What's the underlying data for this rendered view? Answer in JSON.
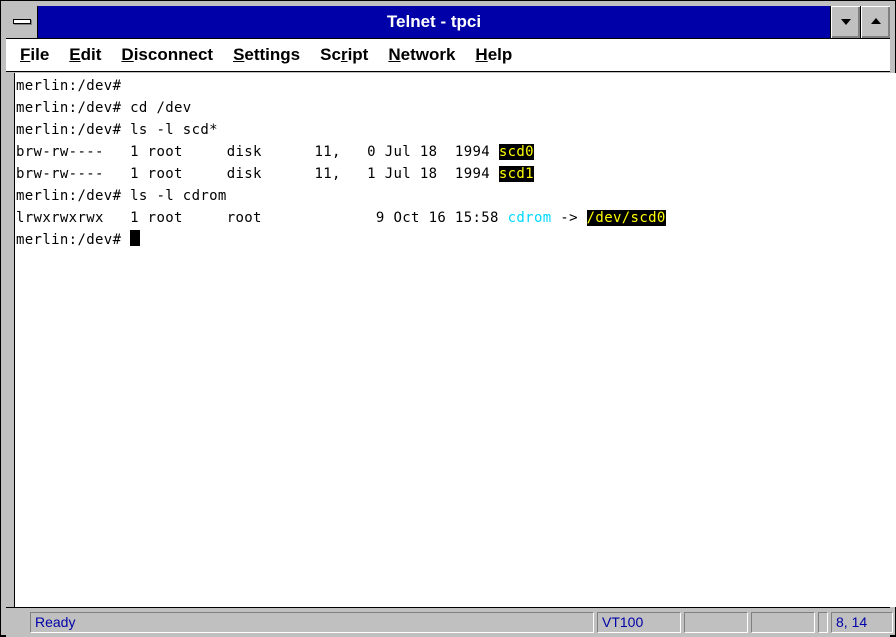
{
  "window": {
    "title": "Telnet - tpci"
  },
  "menu": [
    "File",
    "Edit",
    "Disconnect",
    "Settings",
    "Script",
    "Network",
    "Help"
  ],
  "menu_mnemonics": [
    "F",
    "E",
    "D",
    "S",
    "r",
    "N",
    "H"
  ],
  "terminal": {
    "lines": [
      {
        "prompt": "merlin:/dev#",
        "text": ""
      },
      {
        "prompt": "merlin:/dev#",
        "text": " cd /dev"
      },
      {
        "prompt": "merlin:/dev#",
        "text": " ls -l scd*"
      },
      {
        "prompt": "",
        "text": "brw-rw----   1 root     disk      11,   0 Jul 18  1994 ",
        "highlight": "scd0"
      },
      {
        "prompt": "",
        "text": "brw-rw----   1 root     disk      11,   1 Jul 18  1994 ",
        "highlight": "scd1"
      },
      {
        "prompt": "merlin:/dev#",
        "text": " ls -l cdrom"
      },
      {
        "prompt": "",
        "text": "lrwxrwxrwx   1 root     root             9 Oct 16 15:58 ",
        "link": "cdrom",
        "arrow": " -> ",
        "highlight": "/dev/scd0"
      },
      {
        "prompt": "merlin:/dev#",
        "text": " ",
        "cursor": true
      }
    ]
  },
  "status": {
    "message": "Ready",
    "emulation": "VT100",
    "empty1": "",
    "empty2": "",
    "empty3": "",
    "position": "8, 14"
  },
  "colors": {
    "titlebar": "#0000a8",
    "highlight_fg": "#ffff00",
    "highlight_bg": "#000000",
    "link": "#00d8ff"
  },
  "icons": {
    "system_menu": "system-menu-icon",
    "minimize": "minimize-arrow-icon",
    "maximize": "maximize-arrow-icon"
  }
}
